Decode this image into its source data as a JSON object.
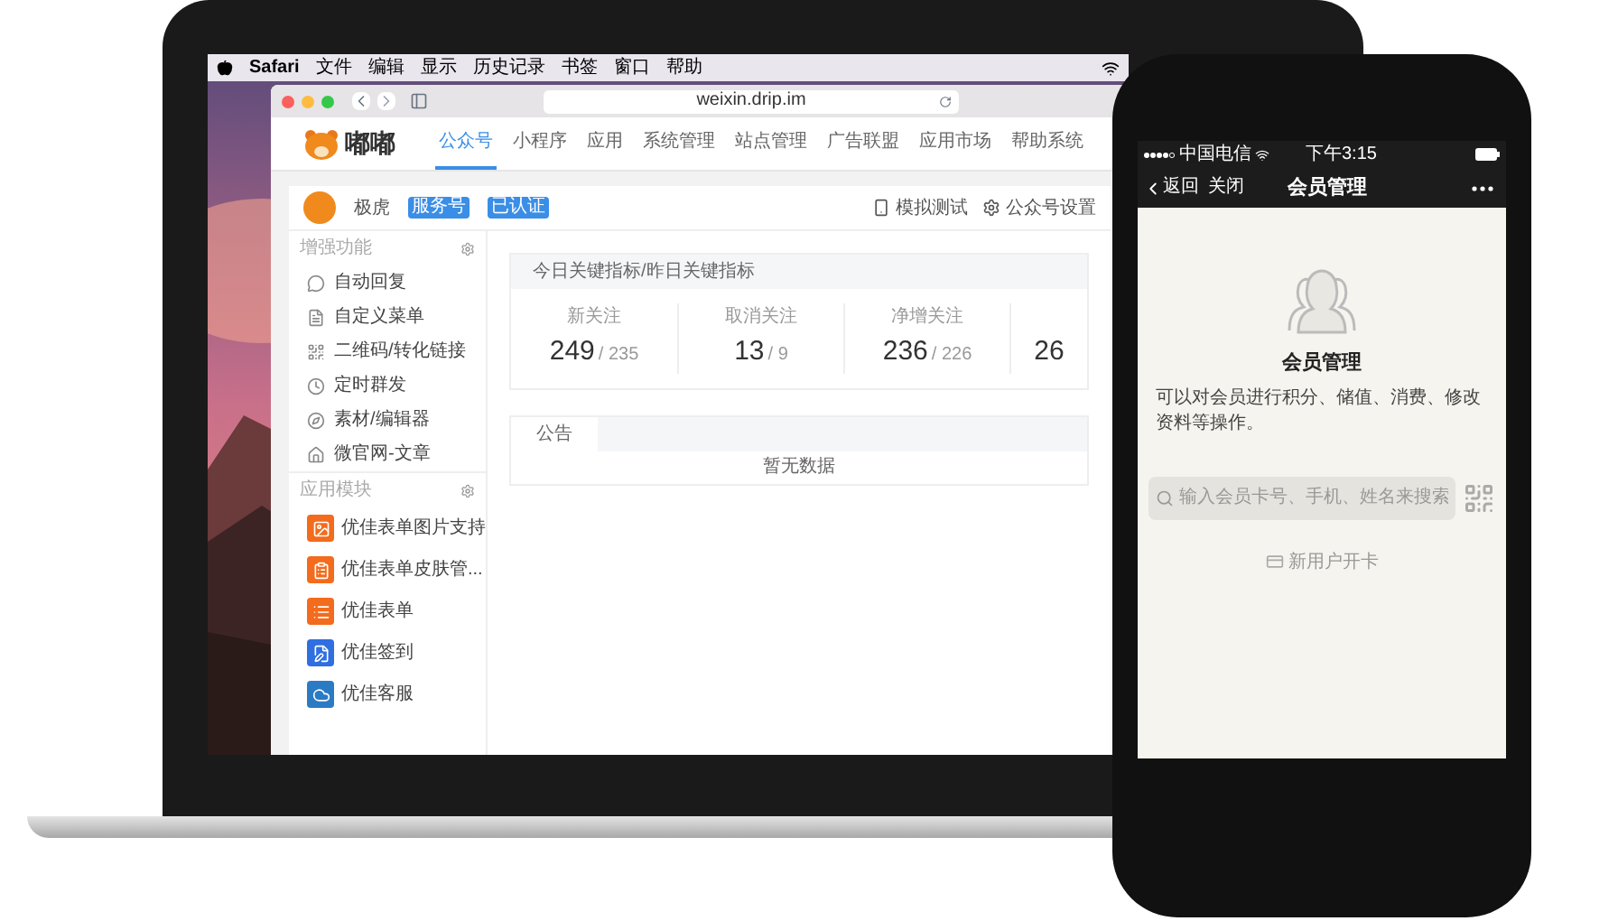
{
  "menubar": {
    "app": "Safari",
    "items": [
      "文件",
      "编辑",
      "显示",
      "历史记录",
      "书签",
      "窗口",
      "帮助"
    ]
  },
  "browser": {
    "url": "weixin.drip.im"
  },
  "site": {
    "logo_text": "嘟嘟",
    "nav": [
      {
        "label": "公众号",
        "selected": true
      },
      {
        "label": "小程序",
        "selected": false
      },
      {
        "label": "应用",
        "selected": false
      },
      {
        "label": "系统管理",
        "selected": false
      },
      {
        "label": "站点管理",
        "selected": false
      },
      {
        "label": "广告联盟",
        "selected": false
      },
      {
        "label": "应用市场",
        "selected": false
      },
      {
        "label": "帮助系统",
        "selected": false
      }
    ]
  },
  "account": {
    "name": "极虎",
    "badges": [
      "服务号",
      "已认证"
    ],
    "actions": [
      {
        "kind": "phone",
        "label": "模拟测试"
      },
      {
        "kind": "gear",
        "label": "公众号设置"
      }
    ]
  },
  "sidebar": {
    "sections": [
      {
        "title": "增强功能",
        "items": [
          {
            "kind": "chat",
            "label": "自动回复"
          },
          {
            "kind": "doc",
            "label": "自定义菜单"
          },
          {
            "kind": "qr",
            "label": "二维码/转化链接"
          },
          {
            "kind": "clock",
            "label": "定时群发"
          },
          {
            "kind": "compass",
            "label": "素材/编辑器"
          },
          {
            "kind": "home",
            "label": "微官网-文章"
          }
        ]
      },
      {
        "title": "应用模块",
        "items": [
          {
            "kind": "app-image",
            "label": "优佳表单图片支持"
          },
          {
            "kind": "app-form",
            "label": "优佳表单皮肤管..."
          },
          {
            "kind": "app-list",
            "label": "优佳表单"
          },
          {
            "kind": "app-sign",
            "label": "优佳签到"
          },
          {
            "kind": "app-service",
            "label": "优佳客服"
          }
        ]
      }
    ]
  },
  "stats": {
    "title": "今日关键指标/昨日关键指标",
    "items": [
      {
        "label": "新关注",
        "today": "249",
        "yesterday": "/ 235"
      },
      {
        "label": "取消关注",
        "today": "13",
        "yesterday": "/ 9"
      },
      {
        "label": "净增关注",
        "today": "236",
        "yesterday": "/ 226"
      },
      {
        "today": "26"
      }
    ]
  },
  "notice": {
    "tab": "公告",
    "empty": "暂无数据"
  },
  "phone": {
    "carrier": "中国电信",
    "time": "下午3:15",
    "back": "返回",
    "close": "关闭",
    "title": "会员管理",
    "heading": "会员管理",
    "description": "可以对会员进行积分、储值、消费、修改资料等操作。",
    "search": {
      "placeholder": "输入会员卡号、手机、姓名来搜索"
    },
    "new_card": "新用户开卡"
  }
}
